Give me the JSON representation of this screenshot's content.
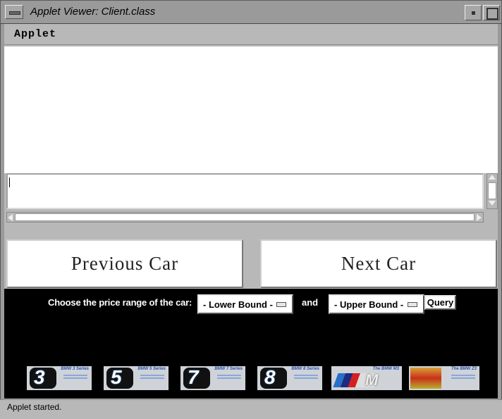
{
  "window": {
    "title": "Applet Viewer: Client.class"
  },
  "menubar": {
    "applet_menu": "Applet"
  },
  "buttons": {
    "previous": "Previous Car",
    "next": "Next Car"
  },
  "query": {
    "label": "Choose the price range of the car:",
    "lower_bound": "- Lower Bound -",
    "and": "and",
    "upper_bound": "- Upper Bound -",
    "query_button": "Query"
  },
  "thumbnails": [
    {
      "name": "bmw-3-series",
      "number": "3",
      "caption": "BMW 3 Series"
    },
    {
      "name": "bmw-5-series",
      "number": "5",
      "caption": "BMW 5 Series"
    },
    {
      "name": "bmw-7-series",
      "number": "7",
      "caption": "BMW 7 Series"
    },
    {
      "name": "bmw-8-series",
      "number": "8",
      "caption": "BMW 8 Series"
    },
    {
      "name": "bmw-m3",
      "number": "M",
      "caption": "The BMW M3"
    },
    {
      "name": "bmw-z3",
      "number": "",
      "caption": "The BMW Z3"
    }
  ],
  "status": {
    "text": "Applet started."
  }
}
